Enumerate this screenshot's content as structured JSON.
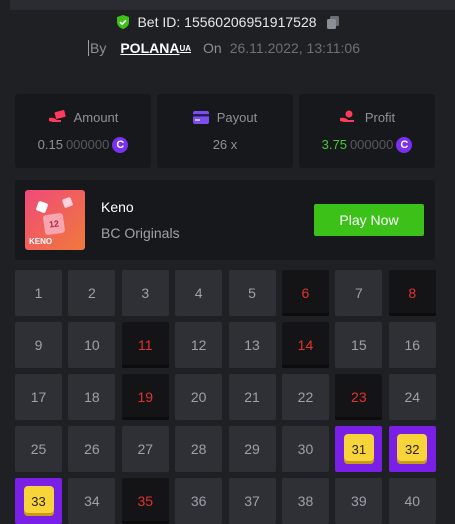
{
  "bet": {
    "id_label": "Bet ID: 15560206951917528",
    "by_label": "By",
    "username": "POLANA",
    "username_suffix": "UA",
    "on_label": "On",
    "date": "26.11.2022, 13:11:06"
  },
  "stats": [
    {
      "label": "Amount",
      "value_main": "0.15",
      "value_dim": "000000",
      "coin": "C",
      "icon": "money-hand-icon"
    },
    {
      "label": "Payout",
      "value_main": "26 x",
      "value_dim": "",
      "coin": "",
      "icon": "card-icon"
    },
    {
      "label": "Profit",
      "value_main": "3.75",
      "value_dim": "000000",
      "coin": "C",
      "icon": "profit-hand-icon"
    }
  ],
  "game": {
    "name": "Keno",
    "provider": "BC Originals",
    "thumb_label": "KENO",
    "thumb_tile": "12",
    "play_label": "Play Now"
  },
  "colors": {
    "accent_green": "#3bc117",
    "miss_red": "#e03232",
    "hit_purple": "#7a1fe6",
    "hit_gold": "#f6d43a",
    "coin_purple": "#7b2ff0"
  },
  "grid": [
    {
      "n": "1",
      "s": "normal"
    },
    {
      "n": "2",
      "s": "normal"
    },
    {
      "n": "3",
      "s": "normal"
    },
    {
      "n": "4",
      "s": "normal"
    },
    {
      "n": "5",
      "s": "normal"
    },
    {
      "n": "6",
      "s": "miss"
    },
    {
      "n": "7",
      "s": "normal"
    },
    {
      "n": "8",
      "s": "miss"
    },
    {
      "n": "9",
      "s": "normal"
    },
    {
      "n": "10",
      "s": "normal"
    },
    {
      "n": "11",
      "s": "miss"
    },
    {
      "n": "12",
      "s": "normal"
    },
    {
      "n": "13",
      "s": "normal"
    },
    {
      "n": "14",
      "s": "miss"
    },
    {
      "n": "15",
      "s": "normal"
    },
    {
      "n": "16",
      "s": "normal"
    },
    {
      "n": "17",
      "s": "normal"
    },
    {
      "n": "18",
      "s": "normal"
    },
    {
      "n": "19",
      "s": "miss"
    },
    {
      "n": "20",
      "s": "normal"
    },
    {
      "n": "21",
      "s": "normal"
    },
    {
      "n": "22",
      "s": "normal"
    },
    {
      "n": "23",
      "s": "miss"
    },
    {
      "n": "24",
      "s": "normal"
    },
    {
      "n": "25",
      "s": "normal"
    },
    {
      "n": "26",
      "s": "normal"
    },
    {
      "n": "27",
      "s": "normal"
    },
    {
      "n": "28",
      "s": "normal"
    },
    {
      "n": "29",
      "s": "normal"
    },
    {
      "n": "30",
      "s": "normal"
    },
    {
      "n": "31",
      "s": "hit"
    },
    {
      "n": "32",
      "s": "hit"
    },
    {
      "n": "33",
      "s": "hit"
    },
    {
      "n": "34",
      "s": "normal"
    },
    {
      "n": "35",
      "s": "miss"
    },
    {
      "n": "36",
      "s": "normal"
    },
    {
      "n": "37",
      "s": "normal"
    },
    {
      "n": "38",
      "s": "normal"
    },
    {
      "n": "39",
      "s": "normal"
    },
    {
      "n": "40",
      "s": "normal"
    }
  ]
}
